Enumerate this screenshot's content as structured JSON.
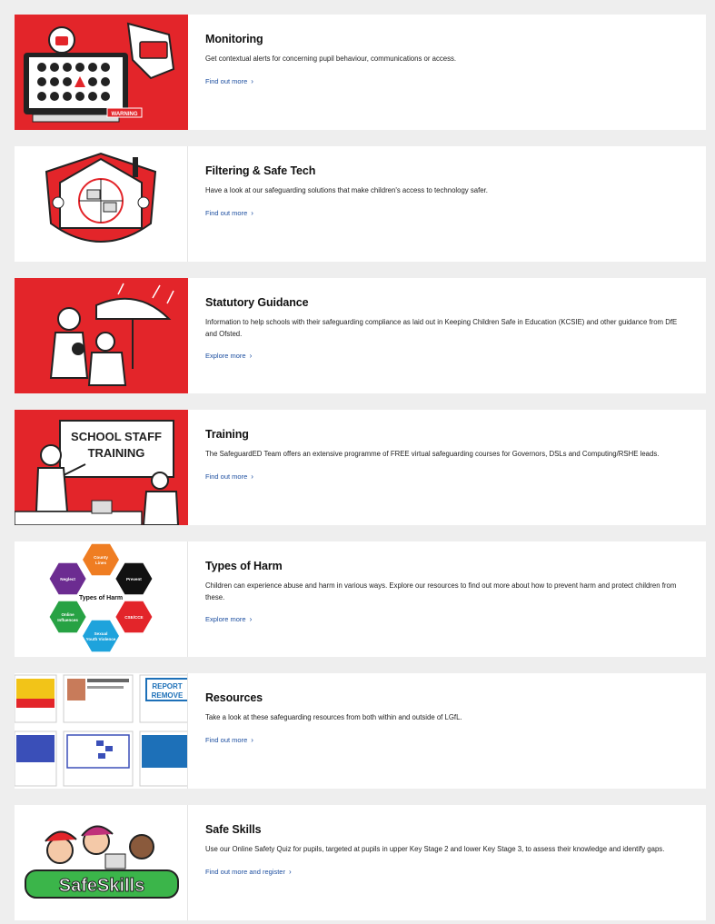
{
  "cards": [
    {
      "title": "Monitoring",
      "description": "Get contextual alerts for concerning pupil behaviour, communications or access.",
      "link": "Find out more",
      "image_text": "WARNING"
    },
    {
      "title": "Filtering & Safe Tech",
      "description": "Have a look at our safeguarding solutions that make children's access to technology safer.",
      "link": "Find out more"
    },
    {
      "title": "Statutory Guidance",
      "description": "Information to help schools with their safeguarding compliance as laid out in Keeping Children Safe in Education (KCSIE) and other guidance from DfE and Ofsted.",
      "link": "Explore more"
    },
    {
      "title": "Training",
      "description": "The SafeguardED Team offers an extensive programme of FREE virtual safeguarding courses for Governors, DSLs and Computing/RSHE leads.",
      "link": "Find out more",
      "image_text": [
        "SCHOOL STAFF",
        "TRAINING"
      ]
    },
    {
      "title": "Types of Harm",
      "description": "Children can experience abuse and harm in various ways. Explore our resources to find out more about how to prevent harm and protect children from these.",
      "link": "Explore more",
      "diagram": {
        "center": "Types of Harm",
        "nodes": [
          {
            "label": "County Lines",
            "color": "#ef7d22"
          },
          {
            "label": "Prevent",
            "color": "#111111"
          },
          {
            "label": "CSE/CCE",
            "color": "#e3252a"
          },
          {
            "label": "Sexual Youth Violence",
            "color": "#1ea3dc"
          },
          {
            "label": "Online Influences",
            "color": "#27a244"
          },
          {
            "label": "Neglect",
            "color": "#6c2c91"
          }
        ]
      }
    },
    {
      "title": "Resources",
      "description": "Take a look at these safeguarding resources from both within and outside of LGfL.",
      "link": "Find out more",
      "image_text": [
        "REPORT",
        "REMOVE"
      ]
    },
    {
      "title": "Safe Skills",
      "description": "Use our Online Safety Quiz for pupils, targeted at pupils in upper Key Stage 2 and lower Key Stage 3, to assess their knowledge and identify gaps.",
      "link": "Find out more and register",
      "image_text": "SafeSkills"
    }
  ],
  "colors": {
    "brand_red": "#e3252a",
    "link_blue": "#1d4fa0",
    "page_bg": "#eeeeee"
  },
  "icons": {
    "link_chevron": "chevron-right-icon"
  }
}
